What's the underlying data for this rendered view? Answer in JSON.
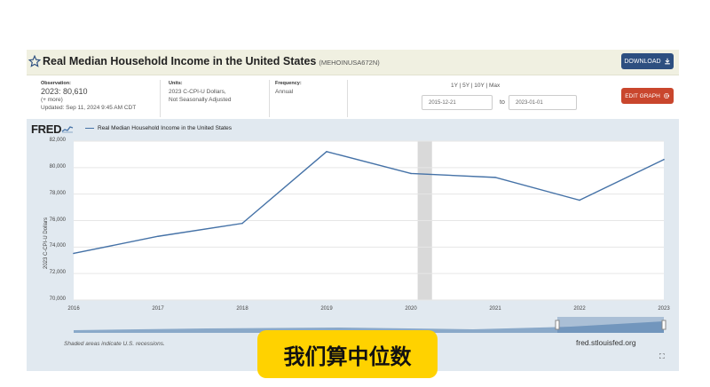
{
  "header": {
    "title": "Real Median Household Income in the United States",
    "series_id": "(MEHOINUSA672N)",
    "download_label": "DOWNLOAD"
  },
  "meta": {
    "observation_label": "Observation:",
    "observation_value": "2023: 80,610",
    "more": "(+ more)",
    "updated": "Updated: Sep 11, 2024 9:45 AM CDT",
    "units_label": "Units:",
    "units_line1": "2023 C-CPI-U Dollars,",
    "units_line2": "Not Seasonally Adjusted",
    "frequency_label": "Frequency:",
    "frequency_value": "Annual"
  },
  "controls": {
    "ranges": "1Y | 5Y | 10Y | Max",
    "start_date": "2015-12-21",
    "to": "to",
    "end_date": "2023-01-01",
    "edit_label": "EDIT GRAPH"
  },
  "fred_logo": "FRED",
  "footer": {
    "recession_note": "Shaded areas indicate U.S. recessions.",
    "source_url": "fred.stlouisfed.org"
  },
  "overlay_caption": "我们算中位数",
  "colors": {
    "series": "#4572a7",
    "download": "#2d4f80",
    "edit": "#c9462d",
    "recession": "#d9d9d9",
    "caption_bg": "#ffd200"
  },
  "chart_data": {
    "type": "line",
    "title": "Real Median Household Income in the United States",
    "ylabel": "2023 C-CPI-U Dollars",
    "xlabel": "",
    "series": [
      {
        "name": "Real Median Household Income in the United States",
        "x": [
          2016,
          2017,
          2018,
          2019,
          2020,
          2021,
          2022,
          2023
        ],
        "values": [
          73520,
          74810,
          75790,
          81210,
          79560,
          79260,
          77540,
          80610
        ]
      }
    ],
    "xlim": [
      2016,
      2023
    ],
    "ylim": [
      70000,
      82000
    ],
    "yticks": [
      70000,
      72000,
      74000,
      76000,
      78000,
      80000,
      82000
    ],
    "ytick_labels": [
      "70,000",
      "72,000",
      "74,000",
      "76,000",
      "78,000",
      "80,000",
      "82,000"
    ],
    "xticks": [
      2016,
      2017,
      2018,
      2019,
      2020,
      2021,
      2022,
      2023
    ],
    "xtick_labels": [
      "2016",
      "2017",
      "2018",
      "2019",
      "2020",
      "2021",
      "2022",
      "2023"
    ],
    "recessions": [
      [
        2020.08,
        2020.25
      ]
    ],
    "grid": true,
    "legend": "top-left"
  }
}
